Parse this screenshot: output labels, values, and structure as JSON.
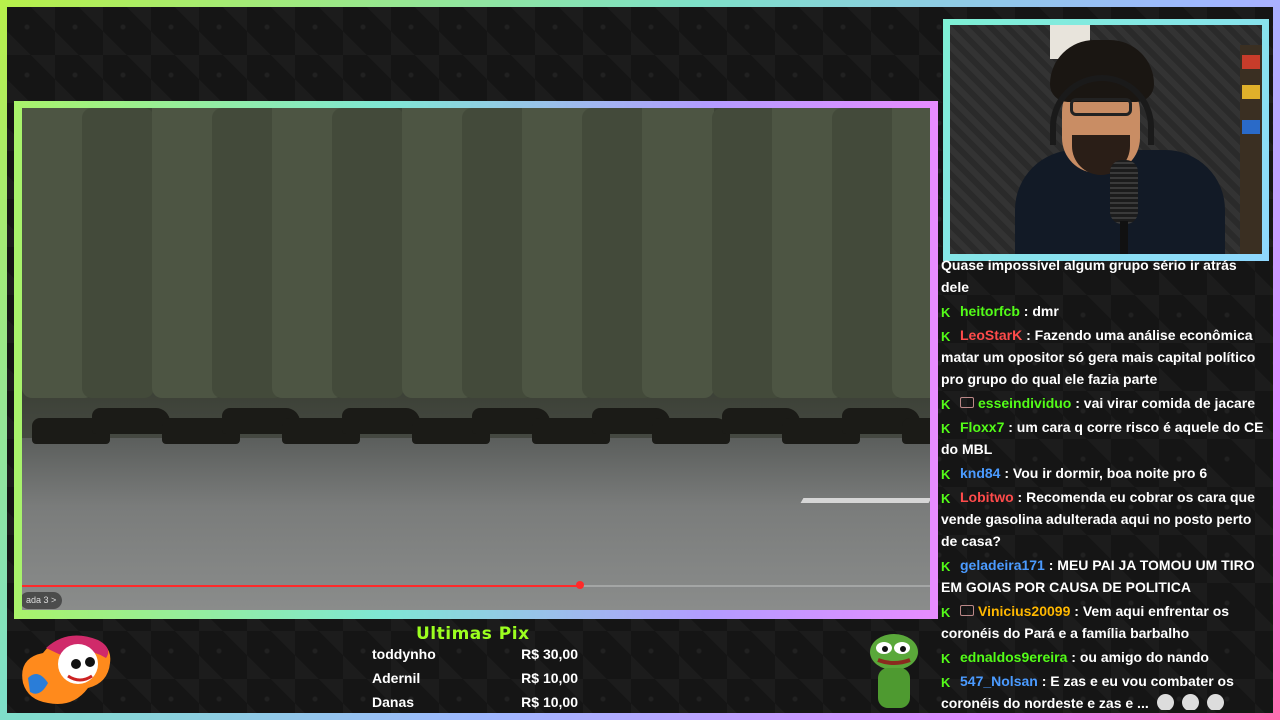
{
  "video": {
    "chapter_label": "ada 3 >",
    "progress_fraction": 0.615,
    "accent_color": "#ff2a2a"
  },
  "chat": {
    "partial_top": "Quase impossível algum grupo sério ir atrás dele",
    "messages": [
      {
        "user": "heitorfcb",
        "color": "#53fc18",
        "text": ": dmr",
        "sub": false
      },
      {
        "user": "LeoStarK",
        "color": "#ff4b4b",
        "text": ": Fazendo uma análise econômica matar um opositor só gera mais capital político pro grupo do qual ele fazia parte",
        "sub": false
      },
      {
        "user": "esseindividuo",
        "color": "#53fc18",
        "text": ": vai virar comida de jacare",
        "sub": true
      },
      {
        "user": "Floxx7",
        "color": "#53fc18",
        "text": ": um cara q corre risco é aquele do CE do MBL",
        "sub": false
      },
      {
        "user": "knd84",
        "color": "#4b9bff",
        "text": ": Vou ir dormir, boa noite pro 6",
        "sub": false
      },
      {
        "user": "Lobitwo",
        "color": "#ff4b4b",
        "text": ": Recomenda eu cobrar os cara que vende gasolina adulterada aqui no posto perto de casa?",
        "sub": false
      },
      {
        "user": "geladeira171",
        "color": "#4b9bff",
        "text": ": MEU PAI JA TOMOU UM TIRO EM GOIAS POR CAUSA DE POLITICA",
        "sub": false
      },
      {
        "user": "Vinicius20099",
        "color": "#ffb800",
        "text": ": Vem aqui enfrentar os coronéis do Pará e a família barbalho",
        "sub": true
      },
      {
        "user": "ednaldos9ereira",
        "color": "#53fc18",
        "text": ": ou amigo do nando",
        "sub": false
      },
      {
        "user": "547_Nolsan",
        "color": "#4b9bff",
        "text": ": E zas e eu vou combater os coronéis do nordeste e zas e ...",
        "sub": false
      }
    ],
    "badge_icon": "kick-badge-icon"
  },
  "pix": {
    "title": "Ultimas Pix",
    "entries": [
      {
        "name": "toddynho",
        "value": "R$ 30,00"
      },
      {
        "name": "Adernil",
        "value": "R$ 10,00"
      },
      {
        "name": "Danas",
        "value": "R$ 10,00"
      }
    ]
  },
  "colors": {
    "border_gradient": [
      "#b8f04a",
      "#7ee0c8",
      "#9fb8ff",
      "#e28cff",
      "#ff6fb0"
    ],
    "pix_title": "#9cff1f"
  }
}
